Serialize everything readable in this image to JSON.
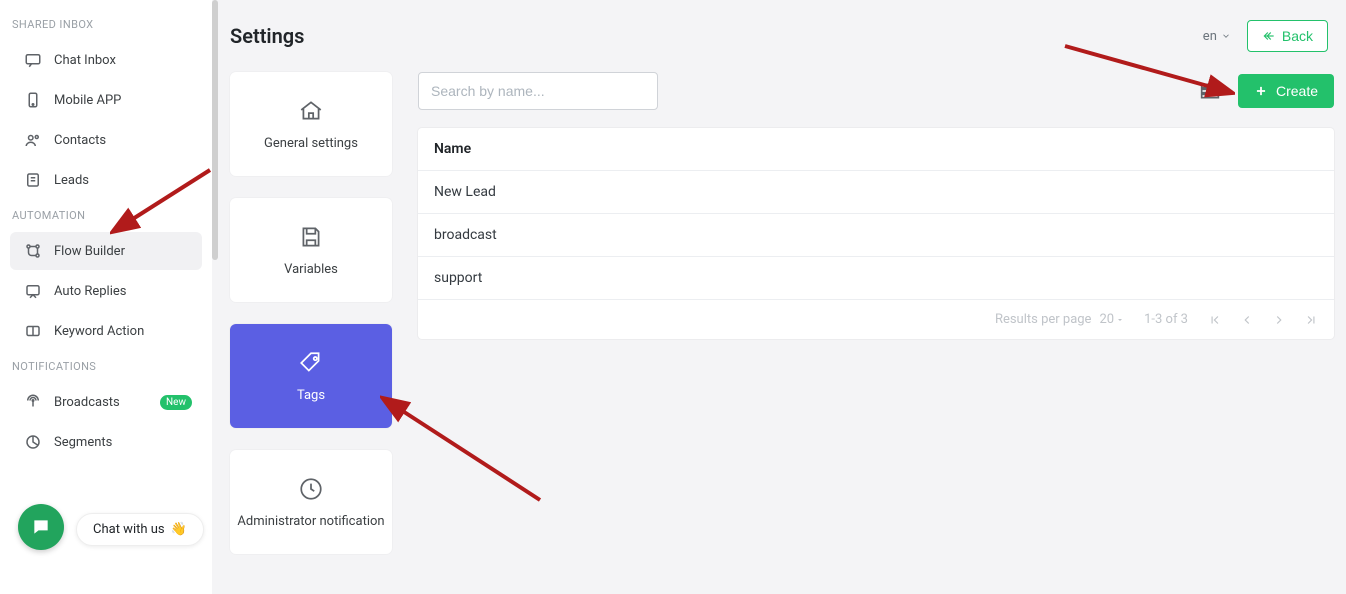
{
  "sidebar": {
    "sections": [
      {
        "title": "SHARED INBOX",
        "items": [
          {
            "label": "Chat Inbox",
            "icon": "chat"
          },
          {
            "label": "Mobile APP",
            "icon": "mobile"
          },
          {
            "label": "Contacts",
            "icon": "contacts"
          },
          {
            "label": "Leads",
            "icon": "leads"
          }
        ]
      },
      {
        "title": "AUTOMATION",
        "items": [
          {
            "label": "Flow Builder",
            "icon": "flow",
            "active": true
          },
          {
            "label": "Auto Replies",
            "icon": "autoreply"
          },
          {
            "label": "Keyword Action",
            "icon": "keyword"
          }
        ]
      },
      {
        "title": "NOTIFICATIONS",
        "items": [
          {
            "label": "Broadcasts",
            "icon": "broadcast",
            "badge": "New"
          },
          {
            "label": "Segments",
            "icon": "segments"
          }
        ]
      }
    ]
  },
  "chat_widget": {
    "label": "Chat with us",
    "emoji": "👋"
  },
  "header": {
    "page_title": "Settings",
    "language": "en",
    "back_label": "Back"
  },
  "tiles": [
    {
      "label": "General settings",
      "icon": "home"
    },
    {
      "label": "Variables",
      "icon": "save"
    },
    {
      "label": "Tags",
      "icon": "tag",
      "selected": true
    },
    {
      "label": "Administrator notification",
      "icon": "bell"
    }
  ],
  "panel": {
    "search_placeholder": "Search by name...",
    "create_label": "Create",
    "columns": [
      "Name"
    ],
    "rows": [
      {
        "name": "New Lead"
      },
      {
        "name": "broadcast"
      },
      {
        "name": "support"
      }
    ],
    "footer": {
      "results_per_page_label": "Results per page",
      "per_page_value": "20",
      "range": "1-3 of 3"
    }
  },
  "colors": {
    "accent_green": "#23c16b",
    "accent_purple": "#5b5fe3",
    "annotation_red": "#b11b1b"
  }
}
